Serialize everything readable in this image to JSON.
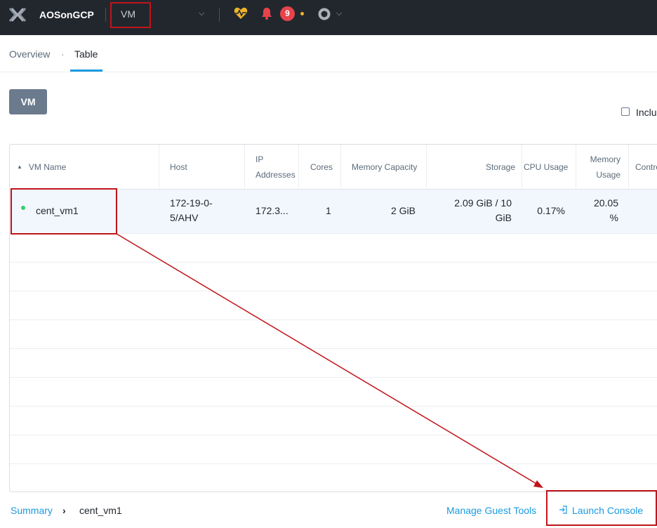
{
  "topbar": {
    "cluster_name": "AOSonGCP",
    "entity_label": "VM",
    "alert_count": "9",
    "icons": [
      "x-logo-icon",
      "health-heart-icon",
      "bell-icon",
      "user-ring-icon",
      "chevron-down-icon"
    ]
  },
  "tabs": {
    "overview": "Overview",
    "separator": "·",
    "table": "Table"
  },
  "vm_button": "VM",
  "include_label": "Inclu",
  "table": {
    "headers": {
      "vm_name": "VM Name",
      "host": "Host",
      "ip_line1": "IP",
      "ip_line2": "Addresses",
      "cores": "Cores",
      "memory_capacity": "Memory Capacity",
      "storage": "Storage",
      "cpu_usage": "CPU Usage",
      "memory_usage_line1": "Memory",
      "memory_usage_line2": "Usage",
      "controller": "Contro"
    },
    "rows": [
      {
        "vm_name": "cent_vm1",
        "host_line1": "172-19-0-",
        "host_line2": "5/AHV",
        "ip": "172.3...",
        "cores": "1",
        "memory_capacity": "2 GiB",
        "storage_line1": "2.09 GiB / 10",
        "storage_line2": "GiB",
        "cpu_usage": "0.17%",
        "memory_usage_line1": "20.05",
        "memory_usage_line2": "%",
        "status_color": "#36d068"
      }
    ]
  },
  "bottom": {
    "summary": "Summary",
    "chevron": "›",
    "selected_vm": "cent_vm1",
    "manage_guest_tools": "Manage Guest Tools",
    "launch_console": "Launch Console"
  },
  "colors": {
    "topbar_bg": "#22272e",
    "accent": "#1b9be0",
    "annotation_red": "#c0141a",
    "badge_red": "#e8434b",
    "vm_button_bg": "#6b7a8d"
  }
}
